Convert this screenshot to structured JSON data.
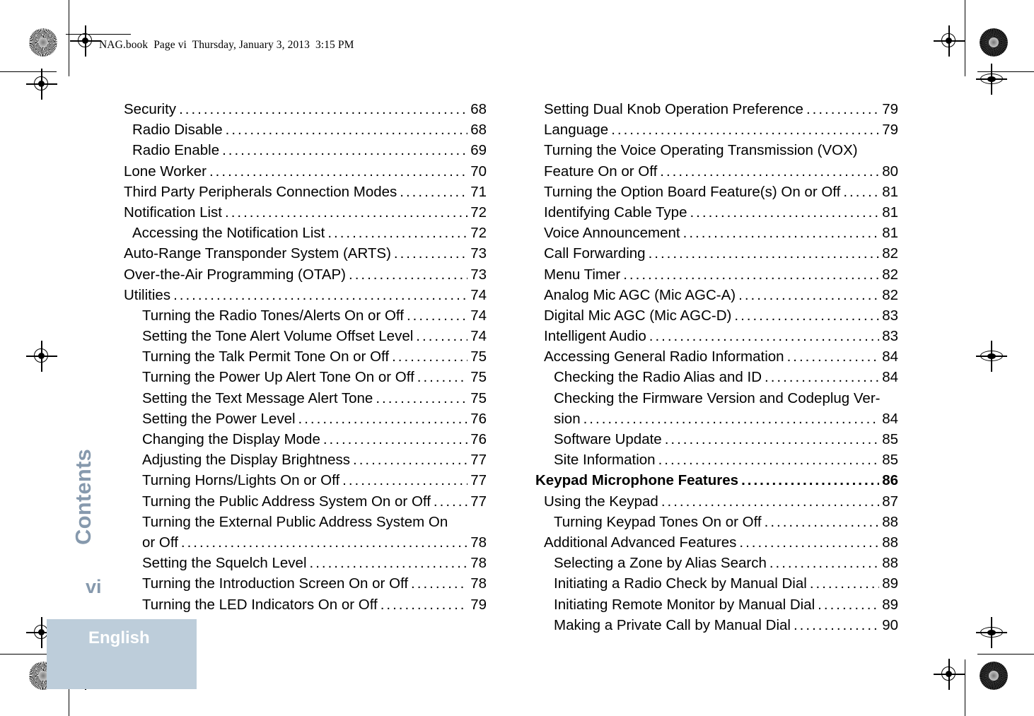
{
  "header": {
    "slug": "NAG.book  Page vi  Thursday, January 3, 2013  3:15 PM"
  },
  "sidebar": {
    "chapter_tab": "Contents",
    "folio": "vi",
    "language": "English",
    "tab_color": "#8699ad",
    "band_color": "#bdcdda",
    "band_text_color": "#ffffff"
  },
  "toc": {
    "left_column": [
      {
        "title": "Security",
        "page": "68",
        "level": 0,
        "bold": false,
        "leader": true
      },
      {
        "title": "Radio Disable",
        "page": "68",
        "level": 1,
        "bold": false,
        "leader": true
      },
      {
        "title": "Radio Enable",
        "page": "69",
        "level": 1,
        "bold": false,
        "leader": true
      },
      {
        "title": "Lone Worker",
        "page": "70",
        "level": 0,
        "bold": false,
        "leader": true
      },
      {
        "title": "Third Party Peripherals Connection Modes",
        "page": "71",
        "level": 0,
        "bold": false,
        "leader": true
      },
      {
        "title": " Notification List",
        "page": "72",
        "level": 0,
        "bold": false,
        "leader": true
      },
      {
        "title": "Accessing the Notification List",
        "page": "72",
        "level": 1,
        "bold": false,
        "leader": true
      },
      {
        "title": "Auto-Range Transponder System (ARTS)",
        "page": "73",
        "level": 0,
        "bold": false,
        "leader": true
      },
      {
        "title": "Over-the-Air Programming (OTAP)",
        "page": "73",
        "level": 0,
        "bold": false,
        "leader": true
      },
      {
        "title": "Utilities",
        "page": "74",
        "level": 0,
        "bold": false,
        "leader": true
      },
      {
        "title": "Turning the Radio Tones/Alerts On or Off",
        "page": "74",
        "level": 2,
        "bold": false,
        "leader": true
      },
      {
        "title": "Setting the Tone Alert Volume Offset Level",
        "page": "74",
        "level": 2,
        "bold": false,
        "leader": true
      },
      {
        "title": "Turning the Talk Permit Tone On or Off",
        "page": "75",
        "level": 2,
        "bold": false,
        "leader": true
      },
      {
        "title": "Turning the Power Up Alert Tone On or Off",
        "page": "75",
        "level": 2,
        "bold": false,
        "leader": true
      },
      {
        "title": "Setting the Text Message Alert Tone",
        "page": "75",
        "level": 2,
        "bold": false,
        "leader": true
      },
      {
        "title": "Setting the Power Level",
        "page": "76",
        "level": 2,
        "bold": false,
        "leader": true
      },
      {
        "title": "Changing the Display Mode",
        "page": "76",
        "level": 2,
        "bold": false,
        "leader": true
      },
      {
        "title": "Adjusting the Display Brightness",
        "page": "77",
        "level": 2,
        "bold": false,
        "leader": true
      },
      {
        "title": "Turning Horns/Lights On or Off",
        "page": "77",
        "level": 2,
        "bold": false,
        "leader": true
      },
      {
        "title": "Turning the Public Address System On or Off",
        "page": "77",
        "level": 2,
        "bold": false,
        "leader": true
      },
      {
        "title": "Turning the External Public Address System On",
        "page": "",
        "level": 2,
        "bold": false,
        "leader": false
      },
      {
        "title": "or Off",
        "page": "78",
        "level": 2,
        "bold": false,
        "leader": true
      },
      {
        "title": "Setting the Squelch Level",
        "page": "78",
        "level": 2,
        "bold": false,
        "leader": true
      },
      {
        "title": "Turning the Introduction Screen On or Off",
        "page": "78",
        "level": 2,
        "bold": false,
        "leader": true
      },
      {
        "title": "Turning the LED Indicators On or Off",
        "page": "79",
        "level": 2,
        "bold": false,
        "leader": true
      }
    ],
    "right_column": [
      {
        "title": "Setting Dual Knob Operation Preference",
        "page": "79",
        "level": 1,
        "bold": false,
        "leader": true
      },
      {
        "title": "Language",
        "page": "79",
        "level": 1,
        "bold": false,
        "leader": true
      },
      {
        "title": "Turning the Voice Operating Transmission (VOX)",
        "page": "",
        "level": 1,
        "bold": false,
        "leader": false
      },
      {
        "title": "Feature On or Off",
        "page": "80",
        "level": 1,
        "bold": false,
        "leader": true
      },
      {
        "title": "Turning the Option Board Feature(s) On or Off",
        "page": "81",
        "level": 1,
        "bold": false,
        "leader": true
      },
      {
        "title": "Identifying Cable Type",
        "page": "81",
        "level": 1,
        "bold": false,
        "leader": true
      },
      {
        "title": "Voice Announcement",
        "page": "81",
        "level": 1,
        "bold": false,
        "leader": true
      },
      {
        "title": "Call Forwarding",
        "page": "82",
        "level": 1,
        "bold": false,
        "leader": true
      },
      {
        "title": "Menu Timer",
        "page": "82",
        "level": 1,
        "bold": false,
        "leader": true
      },
      {
        "title": "Analog Mic AGC (Mic AGC-A)",
        "page": "82",
        "level": 1,
        "bold": false,
        "leader": true
      },
      {
        "title": "Digital Mic AGC (Mic AGC-D)",
        "page": "83",
        "level": 1,
        "bold": false,
        "leader": true
      },
      {
        "title": "Intelligent Audio",
        "page": "83",
        "level": 1,
        "bold": false,
        "leader": true
      },
      {
        "title": "Accessing General Radio Information",
        "page": "84",
        "level": 1,
        "bold": false,
        "leader": true
      },
      {
        "title": "Checking the Radio Alias and ID",
        "page": "84",
        "level": 2,
        "bold": false,
        "leader": true
      },
      {
        "title": "Checking the Firmware Version and Codeplug Ver-",
        "page": "",
        "level": 2,
        "bold": false,
        "leader": false
      },
      {
        "title": "sion",
        "page": "84",
        "level": 2,
        "bold": false,
        "leader": true
      },
      {
        "title": "Software Update",
        "page": "85",
        "level": 2,
        "bold": false,
        "leader": true
      },
      {
        "title": "Site Information",
        "page": "85",
        "level": 2,
        "bold": false,
        "leader": true
      },
      {
        "title": "Keypad Microphone Features",
        "page": "86",
        "level": 0,
        "bold": true,
        "leader": true
      },
      {
        "title": "Using the Keypad",
        "page": "87",
        "level": 1,
        "bold": false,
        "leader": true
      },
      {
        "title": "Turning Keypad Tones On or Off",
        "page": "88",
        "level": 2,
        "bold": false,
        "leader": true
      },
      {
        "title": "Additional Advanced Features",
        "page": "88",
        "level": 1,
        "bold": false,
        "leader": true
      },
      {
        "title": "Selecting a Zone by Alias Search",
        "page": "88",
        "level": 2,
        "bold": false,
        "leader": true
      },
      {
        "title": "Initiating a Radio Check by Manual Dial",
        "page": "89",
        "level": 2,
        "bold": false,
        "leader": true
      },
      {
        "title": "Initiating Remote Monitor by Manual Dial",
        "page": "89",
        "level": 2,
        "bold": false,
        "leader": true
      },
      {
        "title": "Making a Private Call by Manual Dial",
        "page": "90",
        "level": 2,
        "bold": false,
        "leader": true
      }
    ]
  },
  "print_marks": {
    "registration_target": "registration-target-icon",
    "color_calibration": "starburst-calibration-icon",
    "crop_line": "crop-line"
  }
}
